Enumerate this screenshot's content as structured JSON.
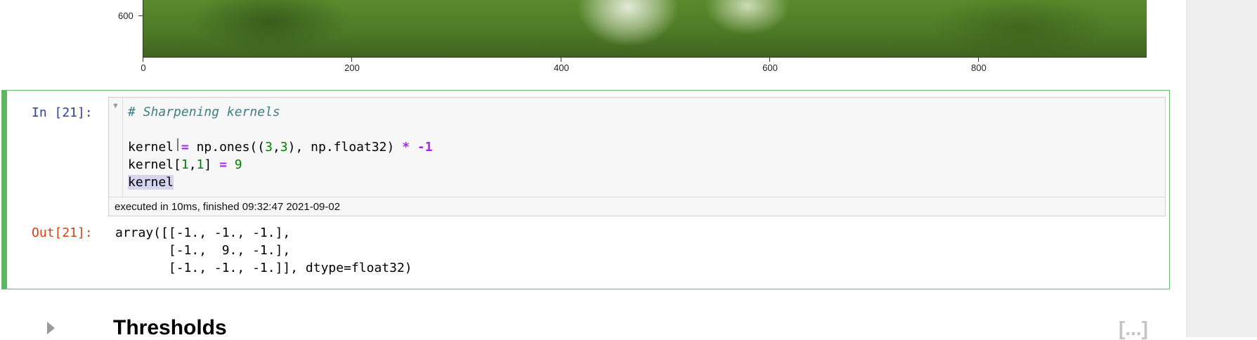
{
  "plot": {
    "y_tick_labels": [
      "600"
    ],
    "x_tick_labels": [
      "0",
      "200",
      "400",
      "600",
      "800"
    ]
  },
  "cell": {
    "input_prompt": "In [21]:",
    "output_prompt": "Out[21]:",
    "collapse_glyph": "▼",
    "code": {
      "comment": "# Sharpening kernels",
      "line2": {
        "var": "kernel",
        "eq": "=",
        "call_a": "np.ones((",
        "n1": "3",
        "comma": ",",
        "n2": "3",
        "call_b": "), np.float32)",
        "mul": "*",
        "neg": "-1"
      },
      "line3": {
        "a": "kernel[",
        "n1": "1",
        "comma": ",",
        "n2": "1",
        "b": "]",
        "eq": "=",
        "n3": "9"
      },
      "line4": "kernel"
    },
    "execution_info": "executed in 10ms, finished 09:32:47 2021-09-02",
    "output_lines": [
      "array([[-1., -1., -1.],",
      "       [-1.,  9., -1.],",
      "       [-1., -1., -1.]], dtype=float32)"
    ]
  },
  "next_cell": {
    "heading": "Thresholds",
    "collapsed_marker": "[...]",
    "expander_icon": "triangle-right-icon"
  }
}
